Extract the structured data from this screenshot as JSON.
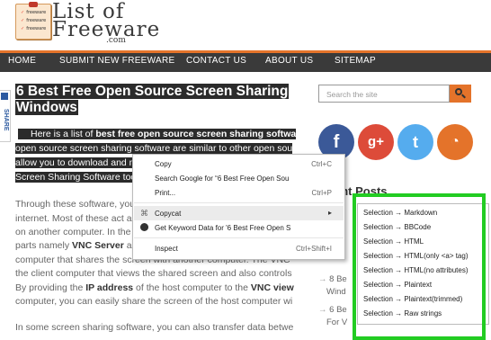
{
  "logo": {
    "line1": "List of",
    "line2": "Freeware",
    "com": ".com",
    "badge_lines": [
      "freeware",
      "freeware",
      "freeware"
    ]
  },
  "nav": [
    "HOME",
    "SUBMIT NEW FREEWARE",
    "CONTACT US",
    "ABOUT US",
    "SITEMAP"
  ],
  "share_label": "SHARE",
  "article": {
    "title_line1": "6 Best Free Open Source Screen Sharing",
    "title_line2": "Windows",
    "p1_l1_a": "Here is a list of ",
    "p1_l1_b": "best free open source screen sharing softwa",
    "p1_l2": "open source screen sharing software are similar to other open sou",
    "p1_l3": "allow you to download and m",
    "p1_l4": "Screen Sharing Software too",
    "p2_l1": "Through these software, you",
    "p2_l2": "internet. Most of these act a",
    "p2_l3": "on another computer. In the",
    "p2_l4_a": "parts namely ",
    "p2_l4_b": "VNC Server",
    "p2_l4_c": " ar",
    "p2_l5": "computer that shares the screen with another computer. The VNC",
    "p2_l6": "the client computer that views the shared screen and also controls",
    "p2_l7_a": "By providing the ",
    "p2_l7_b": "IP address",
    "p2_l7_c": " of the host computer to the ",
    "p2_l7_d": "VNC view",
    "p2_l8": "computer, you can easily share the screen of the host computer wi",
    "p3_l1": "In some screen sharing software, you can also transfer data betwe"
  },
  "sidebar": {
    "search_placeholder": "Search the site",
    "recent_title": "ent Posts",
    "recent_items": [
      "8 Be",
      "Wind",
      "6 Be",
      "For V"
    ]
  },
  "context_menu": {
    "items": [
      {
        "label": "Copy",
        "shortcut": "Ctrl+C"
      },
      {
        "label": "Search Google for “6 Best Free Open Sou",
        "shortcut": ""
      },
      {
        "label": "Print...",
        "shortcut": "Ctrl+P"
      },
      {
        "label": "Copycat",
        "shortcut": ""
      },
      {
        "label": "Get Keyword Data for '6 Best Free Open S",
        "shortcut": ""
      },
      {
        "label": "Inspect",
        "shortcut": "Ctrl+Shift+I"
      }
    ]
  },
  "submenu": {
    "items": [
      "Selection → Markdown",
      "Selection → BBCode",
      "Selection → HTML",
      "Selection → HTML(only <a> tag)",
      "Selection → HTML(no attributes)",
      "Selection → Plaintext",
      "Selection → Plaintext(trimmed)",
      "Selection → Raw strings"
    ]
  },
  "colors": {
    "accent": "#e4732a",
    "nav_bg": "#3a3a3a",
    "highlight_frame": "#22cc22",
    "facebook": "#3b5998",
    "googleplus": "#dd4b39",
    "twitter": "#55acee",
    "rss": "#e4732a"
  },
  "social_icons": [
    "facebook-icon",
    "google-plus-icon",
    "twitter-icon",
    "rss-icon"
  ]
}
